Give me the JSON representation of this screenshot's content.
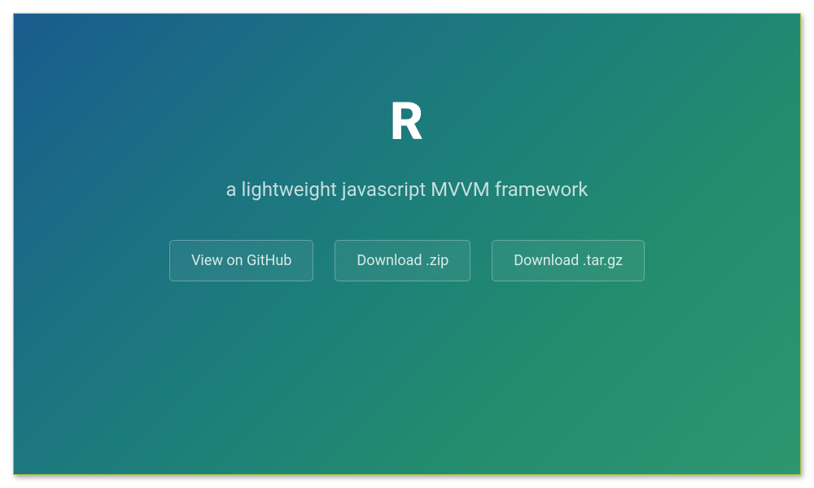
{
  "header": {
    "title": "R",
    "subtitle": "a lightweight javascript MVVM framework"
  },
  "actions": {
    "github": "View on GitHub",
    "zip": "Download .zip",
    "targz": "Download .tar.gz"
  }
}
